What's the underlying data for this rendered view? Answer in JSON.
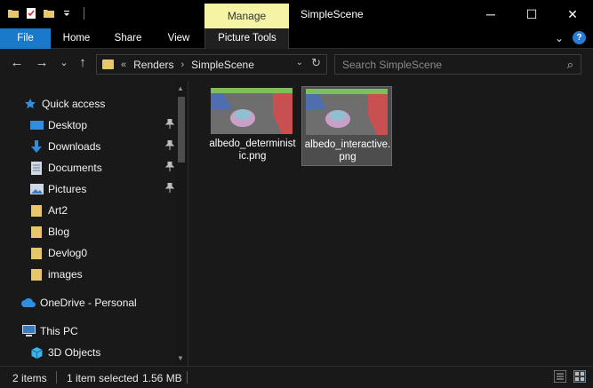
{
  "window": {
    "title": "SimpleScene",
    "manage_tab": "Manage",
    "minimize": "─",
    "maximize": "☐",
    "close": "✕"
  },
  "ribbon": {
    "tabs": [
      "File",
      "Home",
      "Share",
      "View"
    ],
    "picture_tools": "Picture Tools",
    "expand": "⌄",
    "help": "?"
  },
  "nav": {
    "back": "←",
    "forward": "→",
    "recent": "⌄",
    "up": "↑"
  },
  "address": {
    "overflow": "«",
    "crumbs": [
      "Renders",
      "SimpleScene"
    ],
    "separator": "›",
    "dropdown": "⌄",
    "refresh": "↻"
  },
  "search": {
    "placeholder": "Search SimpleScene",
    "icon": "⌕"
  },
  "sidebar": {
    "items": [
      {
        "label": "Quick access",
        "icon": "star-icon",
        "pinned": false
      },
      {
        "label": "Desktop",
        "icon": "desktop-icon",
        "pinned": true
      },
      {
        "label": "Downloads",
        "icon": "download-icon",
        "pinned": true
      },
      {
        "label": "Documents",
        "icon": "document-icon",
        "pinned": true
      },
      {
        "label": "Pictures",
        "icon": "pictures-icon",
        "pinned": true
      },
      {
        "label": "Art2",
        "icon": "folder-icon",
        "pinned": false
      },
      {
        "label": "Blog",
        "icon": "folder-icon",
        "pinned": false
      },
      {
        "label": "Devlog0",
        "icon": "folder-icon",
        "pinned": false
      },
      {
        "label": "images",
        "icon": "folder-icon",
        "pinned": false
      },
      {
        "label": "OneDrive - Personal",
        "icon": "cloud-icon",
        "pinned": false
      },
      {
        "label": "This PC",
        "icon": "pc-icon",
        "pinned": false
      },
      {
        "label": "3D Objects",
        "icon": "cube-icon",
        "pinned": false
      }
    ],
    "pin_glyph": "📌"
  },
  "files": [
    {
      "name": "albedo_deterministic.png",
      "selected": false
    },
    {
      "name": "albedo_interactive.png",
      "selected": true
    }
  ],
  "status": {
    "item_count": "2 items",
    "selection": "1 item selected",
    "size": "1.56 MB"
  },
  "colors": {
    "accent": "#1979ca",
    "manage": "#f5f4a5",
    "folder": "#e8c66a",
    "background": "#191919"
  }
}
